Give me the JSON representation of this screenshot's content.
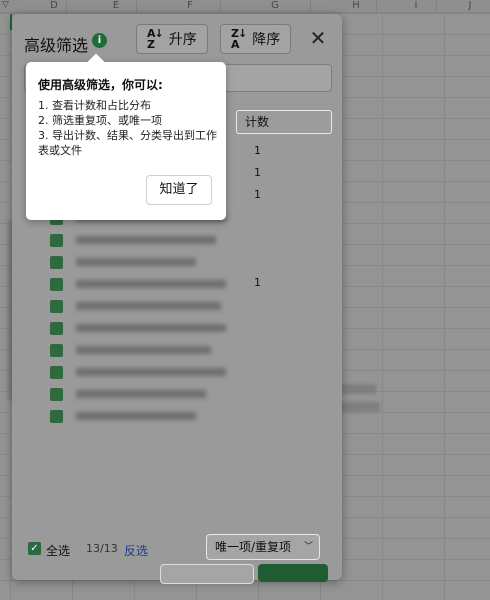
{
  "sheet": {
    "columns": [
      "D",
      "E",
      "F",
      "G",
      "H",
      "I",
      "J"
    ]
  },
  "panel": {
    "title": "高级筛选",
    "info_icon": "i",
    "sort_asc_label": "升序",
    "sort_desc_label": "降序",
    "close_label": "✕",
    "count_header": "计数",
    "rows": [
      {
        "count": "1"
      },
      {
        "count": "1"
      },
      {
        "count": "1"
      },
      {
        "count": ""
      },
      {
        "count": ""
      },
      {
        "count": ""
      },
      {
        "count": "1"
      },
      {
        "count": ""
      },
      {
        "count": ""
      },
      {
        "count": ""
      },
      {
        "count": ""
      },
      {
        "count": ""
      },
      {
        "count": ""
      }
    ],
    "footer": {
      "select_all_label": "全选",
      "select_count": "13/13",
      "invert_label": "反选",
      "mode_select_value": "唯一项/重复项"
    }
  },
  "popover": {
    "heading": "使用高级筛选，你可以:",
    "items": [
      "1. 查看计数和占比分布",
      "2. 筛选重复项、或唯一项",
      "3. 导出计数、结果、分类导出到工作表或文件"
    ],
    "ok_label": "知道了"
  }
}
